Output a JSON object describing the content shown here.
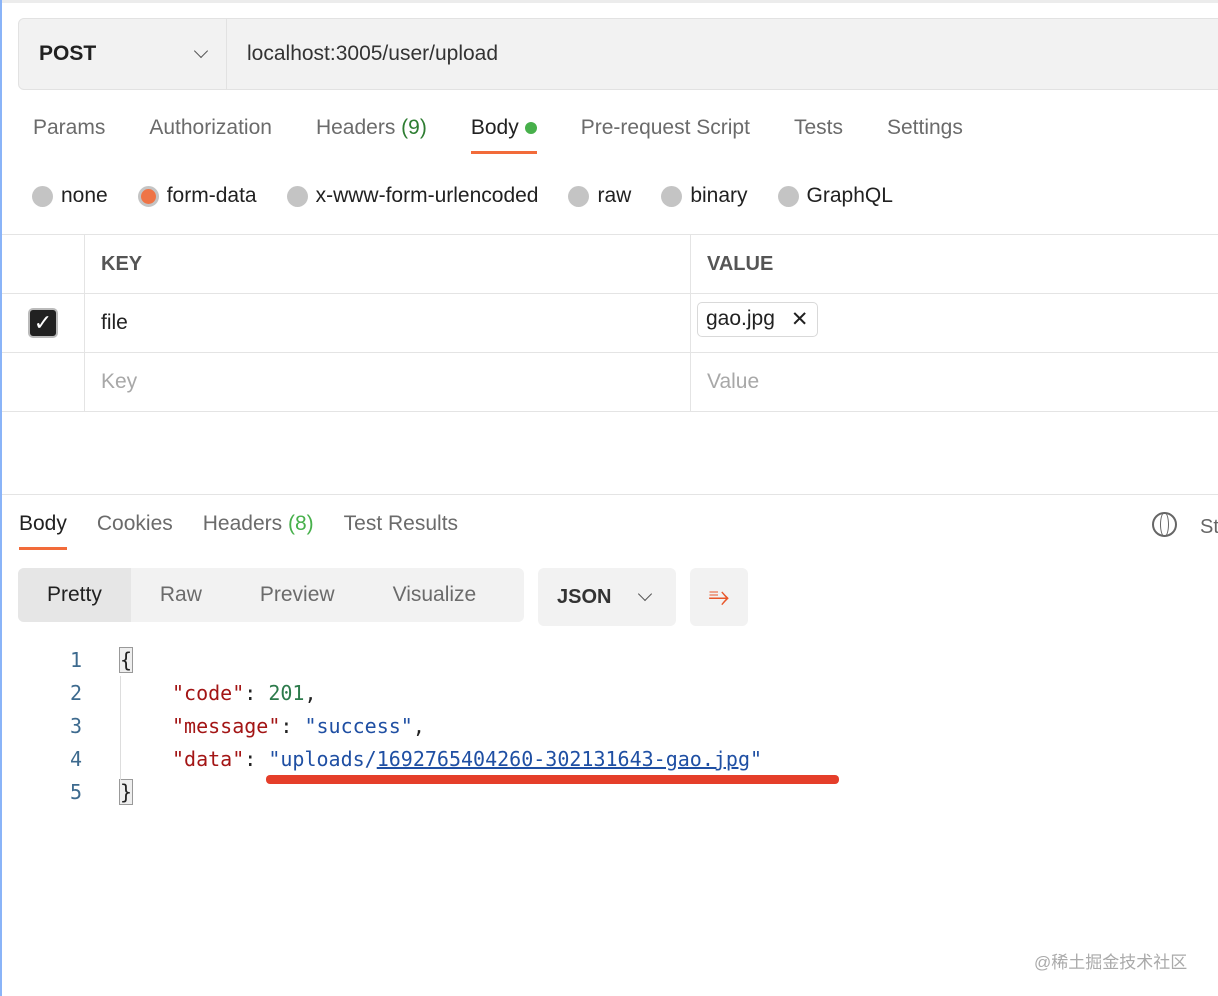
{
  "request": {
    "method": "POST",
    "url": "localhost:3005/user/upload"
  },
  "tabs": [
    {
      "label": "Params"
    },
    {
      "label": "Authorization"
    },
    {
      "label": "Headers",
      "count": "(9)"
    },
    {
      "label": "Body"
    },
    {
      "label": "Pre-request Script"
    },
    {
      "label": "Tests"
    },
    {
      "label": "Settings"
    }
  ],
  "body_types": [
    "none",
    "form-data",
    "x-www-form-urlencoded",
    "raw",
    "binary",
    "GraphQL"
  ],
  "selected_body_type": "form-data",
  "form": {
    "key_header": "KEY",
    "value_header": "VALUE",
    "rows": [
      {
        "checked": true,
        "key": "file",
        "value": "gao.jpg"
      }
    ],
    "key_placeholder": "Key",
    "value_placeholder": "Value"
  },
  "response": {
    "tabs": [
      {
        "label": "Body"
      },
      {
        "label": "Cookies"
      },
      {
        "label": "Headers",
        "count": "(8)"
      },
      {
        "label": "Test Results"
      }
    ],
    "status_partial": "St",
    "views": [
      "Pretty",
      "Raw",
      "Preview",
      "Visualize"
    ],
    "format": "JSON",
    "lines": [
      "1",
      "2",
      "3",
      "4",
      "5"
    ],
    "json": {
      "open": "{",
      "code_key": "\"code\"",
      "code_val": "201",
      "msg_key": "\"message\"",
      "msg_val": "\"success\"",
      "data_key": "\"data\"",
      "data_val_q": "\"",
      "data_val_a": "uploads/",
      "data_val_b": "1692765404260-302131643-gao.jpg",
      "close": "}"
    }
  },
  "watermark": "@稀土掘金技术社区",
  "colors": {
    "accent": "#f26b3a",
    "highlight": "#e53e2a"
  }
}
